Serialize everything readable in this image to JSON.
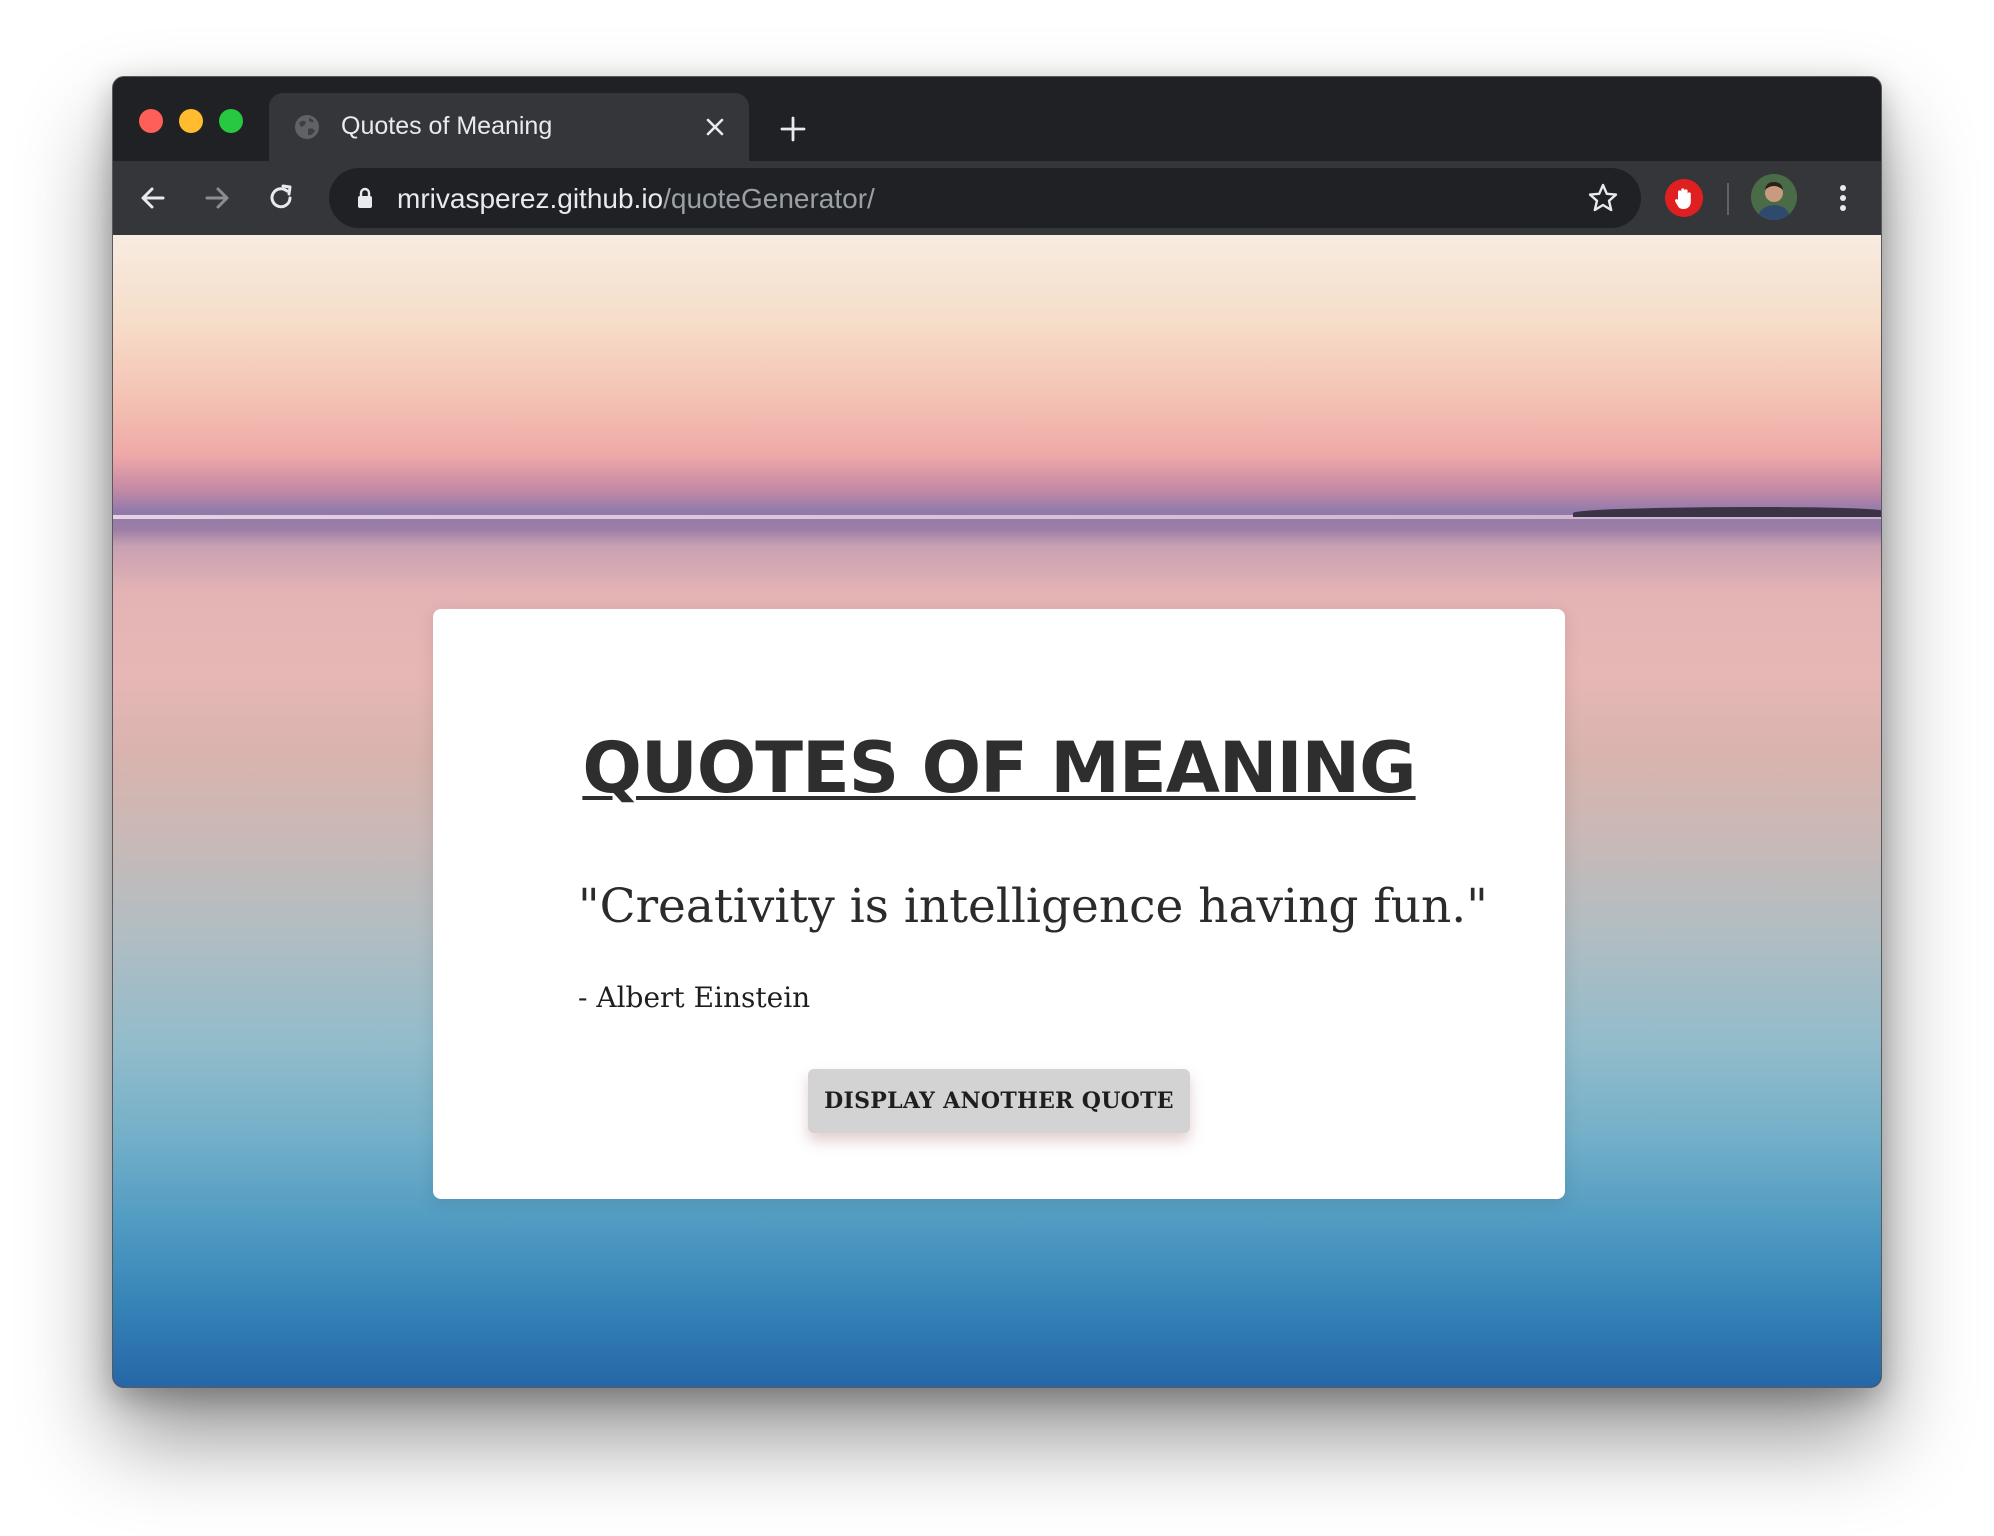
{
  "browser": {
    "tab": {
      "title": "Quotes of Meaning",
      "favicon": "globe-icon",
      "close_icon": "close-icon"
    },
    "new_tab_icon": "plus-icon",
    "toolbar": {
      "back_icon": "arrow-left-icon",
      "forward_icon": "arrow-right-icon",
      "reload_icon": "reload-icon",
      "url_host": "mrivasperez.github.io",
      "url_path": "/quoteGenerator/",
      "lock_icon": "lock-icon",
      "bookmark_icon": "star-icon",
      "extension_icon": "stop-hand-icon",
      "menu_icon": "kebab-menu-icon"
    },
    "colors": {
      "traffic_red": "#fe5f57",
      "traffic_yellow": "#febc2e",
      "traffic_green": "#28c840",
      "chrome_dark": "#202124",
      "chrome_toolbar": "#35363a"
    }
  },
  "page": {
    "title": "QUOTES OF MEANING",
    "quote": "\"Creativity is intelligence having fun.\"",
    "author": "- Albert Einstein",
    "button_label": "DISPLAY ANOTHER QUOTE"
  }
}
